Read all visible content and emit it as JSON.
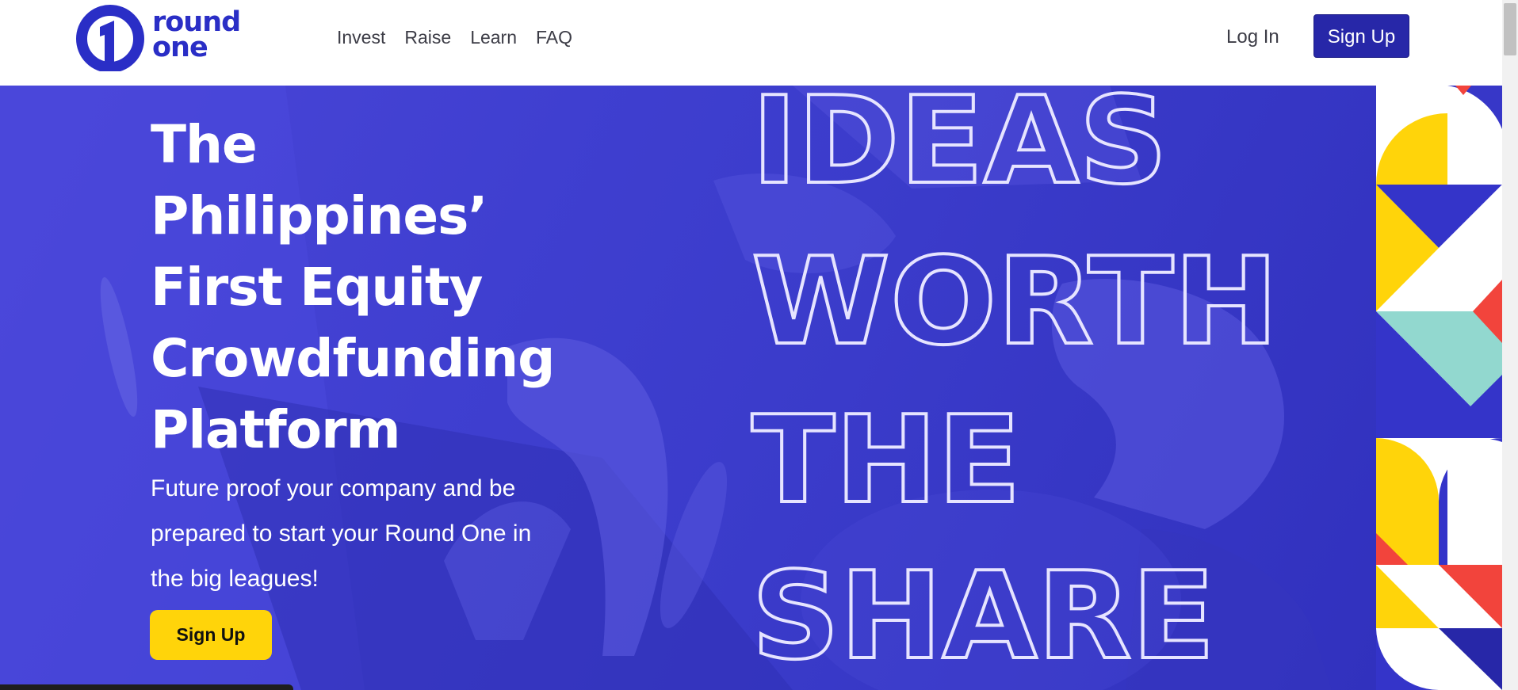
{
  "brand": {
    "name_line1": "round",
    "name_line2": "one",
    "logo_icon": "round-one-logo-icon"
  },
  "nav": {
    "links": [
      "Invest",
      "Raise",
      "Learn",
      "FAQ"
    ],
    "login_label": "Log In",
    "signup_label": "Sign Up"
  },
  "hero": {
    "headline_lines": [
      "The",
      "Philippines’",
      "First Equity",
      "Crowdfunding",
      "Platform"
    ],
    "subtext_lines": [
      "Future proof your company and be",
      "prepared to start your Round One in",
      "the big leagues!"
    ],
    "cta_label": "Sign Up",
    "outline_words": [
      "IDEAS",
      "WORTH",
      "THE",
      "SHARE"
    ]
  },
  "colors": {
    "brand_blue": "#2a2ec6",
    "button_blue": "#2727a8",
    "hero_blue": "#3d3ecd",
    "cta_yellow": "#ffd40a",
    "accent_red": "#f2443c",
    "accent_teal": "#92d8cf"
  }
}
